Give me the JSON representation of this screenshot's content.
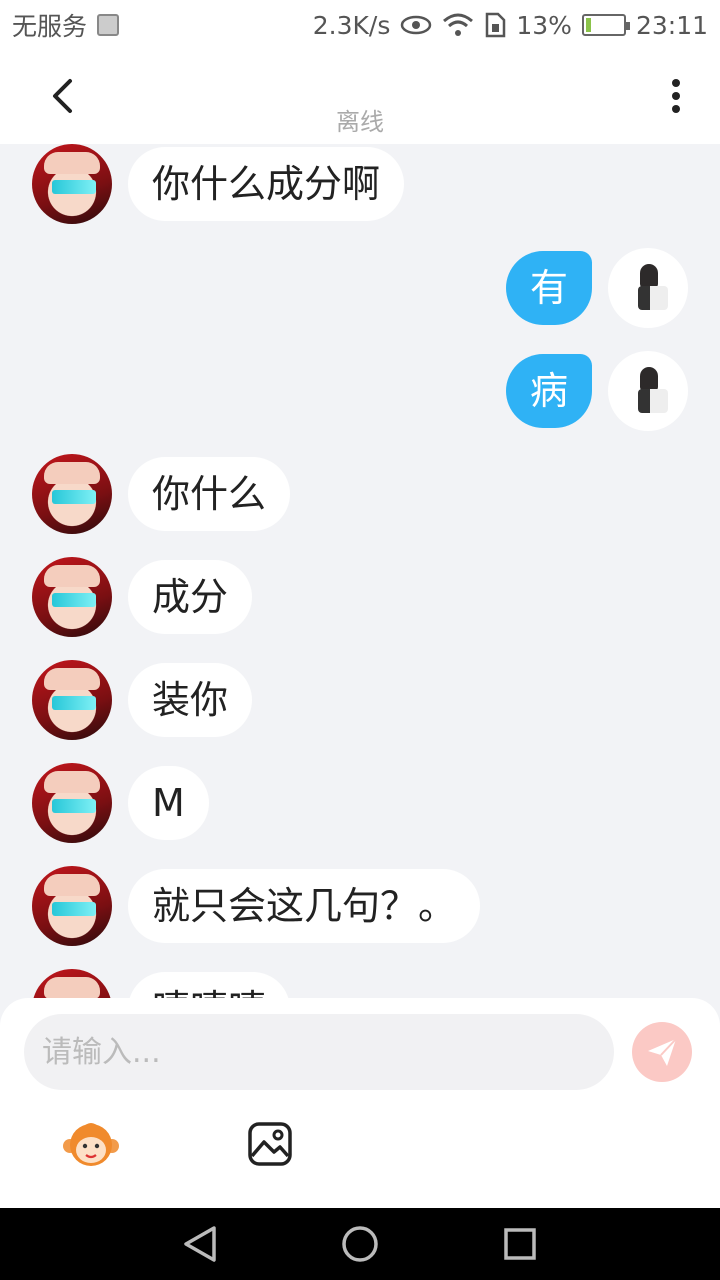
{
  "status_bar": {
    "carrier": "无服务",
    "net_speed": "2.3K/s",
    "battery_pct": "13%",
    "battery_level": 0.13,
    "time": "23:11"
  },
  "header": {
    "status": "离线"
  },
  "messages": [
    {
      "side": "left",
      "text": "你什么成分啊"
    },
    {
      "side": "right",
      "text": "有"
    },
    {
      "side": "right",
      "text": "病"
    },
    {
      "side": "left",
      "text": "你什么"
    },
    {
      "side": "left",
      "text": "成分"
    },
    {
      "side": "left",
      "text": "装你"
    },
    {
      "side": "left",
      "text": "M"
    },
    {
      "side": "left",
      "text": "就只会这几句？。"
    },
    {
      "side": "left",
      "text": "嘻嘻嘻"
    }
  ],
  "input": {
    "placeholder": "请输入..."
  },
  "icons": {
    "back": "chevron-left-icon",
    "more": "more-vertical-icon",
    "send": "paper-plane-icon",
    "emoji": "monkey-emoji-icon",
    "image": "image-icon",
    "nav_back": "triangle-back-icon",
    "nav_home": "circle-home-icon",
    "nav_recent": "square-recent-icon"
  },
  "colors": {
    "bubble_self": "#2fb2f5",
    "bubble_other": "#ffffff",
    "background": "#f2f3f6",
    "send_button": "#fbc9c5"
  }
}
